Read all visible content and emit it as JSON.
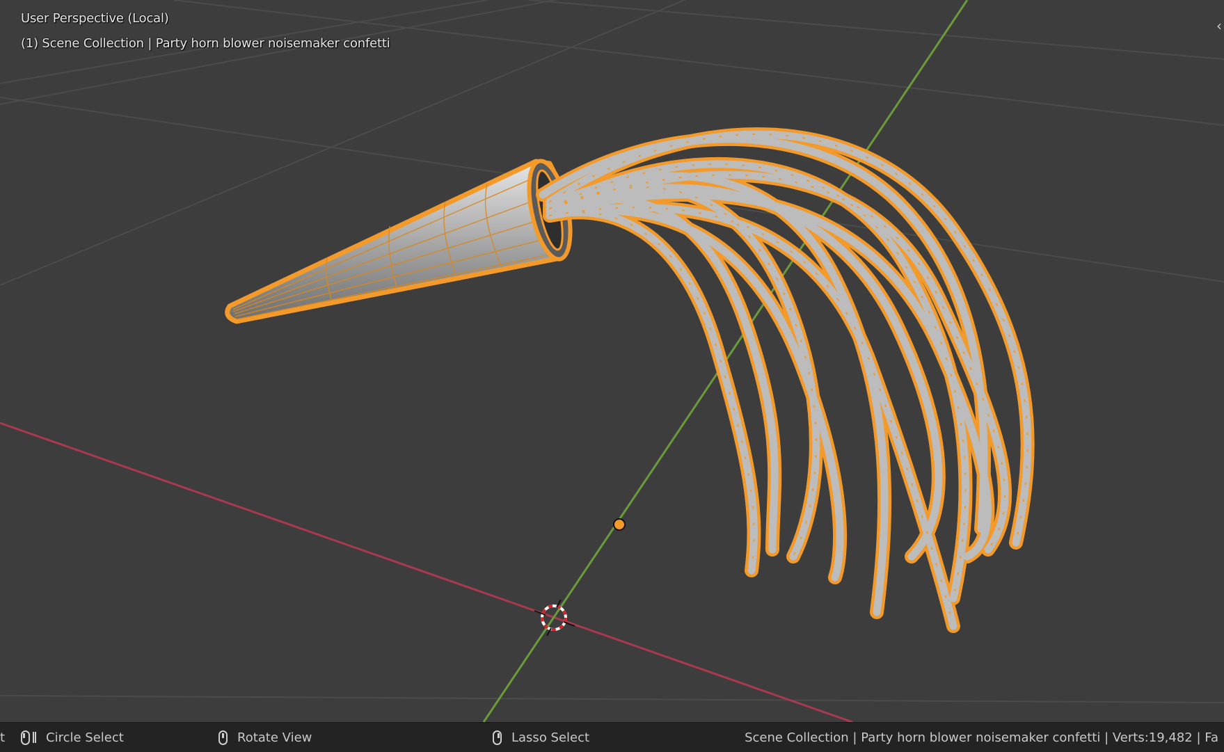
{
  "viewport": {
    "view_title": "User Perspective (Local)",
    "scene_info": "(1) Scene Collection | Party horn blower noisemaker confetti",
    "colors": {
      "background": "#3d3d3d",
      "grid": "#4a4a4a",
      "x_axis": "#a9394f",
      "y_axis": "#6c9a3a",
      "selection_outline": "#f39a2a",
      "mesh_fill": "#b4b4b4"
    }
  },
  "statusbar": {
    "left_cutoff": "t",
    "circle_select": "Circle Select",
    "rotate_view": "Rotate View",
    "lasso_select": "Lasso Select",
    "stats": "Scene Collection | Party horn blower noisemaker confetti | Verts:19,482 | Fa"
  },
  "icons": {
    "collapse": "chevron-left-icon",
    "cursor": "3d-cursor-icon",
    "origin": "object-origin-icon"
  }
}
